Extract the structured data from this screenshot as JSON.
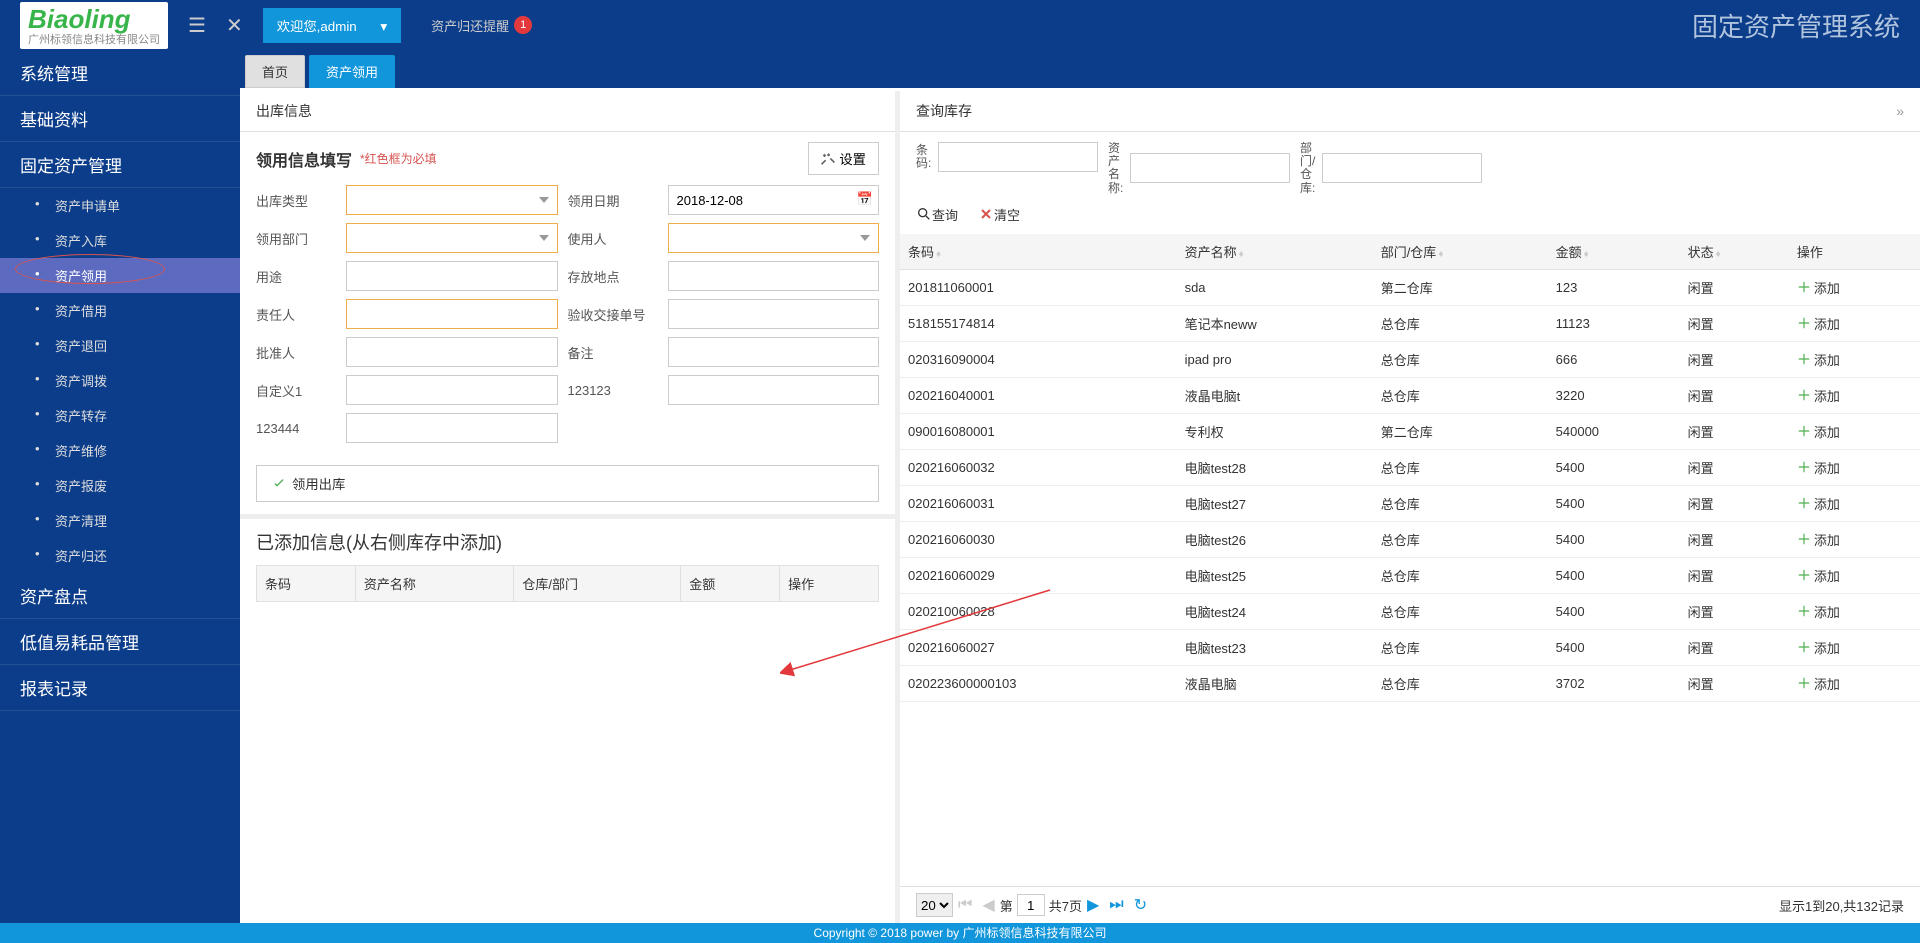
{
  "header": {
    "logo_main": "Biaoling",
    "logo_sub": "广州标领信息科技有限公司",
    "welcome": "欢迎您,admin",
    "reminder_text": "资产归还提醒",
    "reminder_count": "1",
    "system_title": "固定资产管理系统"
  },
  "sidebar": {
    "groups": [
      "系统管理",
      "基础资料",
      "固定资产管理"
    ],
    "asset_items": [
      "资产申请单",
      "资产入库",
      "资产领用",
      "资产借用",
      "资产退回",
      "资产调拨",
      "资产转存",
      "资产维修",
      "资产报废",
      "资产清理",
      "资产归还"
    ],
    "bottom_groups": [
      "资产盘点",
      "低值易耗品管理",
      "报表记录"
    ]
  },
  "tabs": {
    "home": "首页",
    "active": "资产领用"
  },
  "left": {
    "panel_title": "出库信息",
    "form_title": "领用信息填写",
    "form_hint": "*红色框为必填",
    "settings": "设置",
    "labels": {
      "type": "出库类型",
      "date": "领用日期",
      "dept": "领用部门",
      "user": "使用人",
      "use": "用途",
      "loc": "存放地点",
      "resp": "责任人",
      "receipt": "验收交接单号",
      "approver": "批准人",
      "remark": "备注",
      "custom1": "自定义1",
      "custom2_val": "123123",
      "custom3_val": "123444"
    },
    "date_value": "2018-12-08",
    "submit": "领用出库",
    "added_title": "已添加信息(从右侧库存中添加)",
    "added_cols": [
      "条码",
      "资产名称",
      "仓库/部门",
      "金额",
      "操作"
    ]
  },
  "right": {
    "panel_title": "查询库存",
    "search_labels": {
      "barcode": "条码:",
      "name": "资产名称:",
      "dept": "部门/仓库:"
    },
    "search_btn": "查询",
    "clear_btn": "清空",
    "cols": [
      "条码",
      "资产名称",
      "部门/仓库",
      "金额",
      "状态",
      "操作"
    ],
    "add_label": "添加",
    "rows": [
      {
        "code": "201811060001",
        "name": "sda",
        "dept": "第二仓库",
        "amt": "123",
        "st": "闲置"
      },
      {
        "code": "518155174814",
        "name": "笔记本neww",
        "dept": "总仓库",
        "amt": "11123",
        "st": "闲置"
      },
      {
        "code": "020316090004",
        "name": "ipad pro",
        "dept": "总仓库",
        "amt": "666",
        "st": "闲置"
      },
      {
        "code": "020216040001",
        "name": "液晶电脑t",
        "dept": "总仓库",
        "amt": "3220",
        "st": "闲置"
      },
      {
        "code": "090016080001",
        "name": "专利权",
        "dept": "第二仓库",
        "amt": "540000",
        "st": "闲置"
      },
      {
        "code": "020216060032",
        "name": "电脑test28",
        "dept": "总仓库",
        "amt": "5400",
        "st": "闲置"
      },
      {
        "code": "020216060031",
        "name": "电脑test27",
        "dept": "总仓库",
        "amt": "5400",
        "st": "闲置"
      },
      {
        "code": "020216060030",
        "name": "电脑test26",
        "dept": "总仓库",
        "amt": "5400",
        "st": "闲置"
      },
      {
        "code": "020216060029",
        "name": "电脑test25",
        "dept": "总仓库",
        "amt": "5400",
        "st": "闲置"
      },
      {
        "code": "020210060028",
        "name": "电脑test24",
        "dept": "总仓库",
        "amt": "5400",
        "st": "闲置"
      },
      {
        "code": "020216060027",
        "name": "电脑test23",
        "dept": "总仓库",
        "amt": "5400",
        "st": "闲置"
      },
      {
        "code": "020223600000103",
        "name": "液晶电脑",
        "dept": "总仓库",
        "amt": "3702",
        "st": "闲置"
      }
    ],
    "pager": {
      "size": "20",
      "page": "1",
      "total_pages": "共7页",
      "info": "显示1到20,共132记录",
      "page_label": "第"
    }
  },
  "footer": "Copyright © 2018 power by 广州标领信息科技有限公司"
}
